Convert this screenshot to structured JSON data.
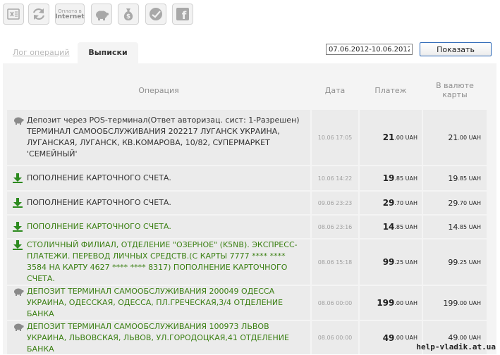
{
  "toolbar": {
    "buttons": [
      {
        "icon": "excel-icon"
      },
      {
        "icon": "refresh-icon"
      },
      {
        "icon": "internet-payment-icon",
        "line1": "Оплата в",
        "line2": "Internet"
      },
      {
        "icon": "piggy-bank-icon"
      },
      {
        "icon": "money-bag-icon"
      },
      {
        "icon": "check-circle-icon"
      },
      {
        "icon": "facebook-icon",
        "glyph": "f"
      }
    ]
  },
  "tabs": {
    "log": "Лог операций",
    "statements": "Выписки"
  },
  "filter": {
    "date_range": "07.06.2012-10.06.2012",
    "show_button": "Показать"
  },
  "table": {
    "headers": {
      "operation": "Операция",
      "date": "Дата",
      "payment": "Платеж",
      "card_currency_line1": "В валюте",
      "card_currency_line2": "карты"
    },
    "rows": [
      {
        "icon": "piggy-bank-icon",
        "text": "Депозит через POS-терминал(Ответ авторизац. сист: 1-Разрешен) ТЕРМИНАЛ САМООБСЛУЖИВАНИЯ 202217 ЛУГАНСК УКРАИНА, ЛУГАНСКАЯ, ЛУГАНСК, КВ.КОМАРОВА, 10/82, СУПЕРМАРКЕТ 'СЕМЕЙНЫЙ'",
        "green": false,
        "date": "10.06 17:05",
        "pay_int": "21",
        "pay_dec": ".00 UAH",
        "card_int": "21",
        "card_dec": ".00 UAH"
      },
      {
        "icon": "arrow-down-icon",
        "text": "ПОПОЛНЕНИЕ КАРТОЧНОГО СЧЕТА.",
        "green": false,
        "date": "10.06 14:22",
        "pay_int": "19",
        "pay_dec": ".85 UAH",
        "card_int": "19",
        "card_dec": ".85 UAH"
      },
      {
        "icon": "arrow-down-icon",
        "text": "ПОПОЛНЕНИЕ КАРТОЧНОГО СЧЕТА.",
        "green": false,
        "date": "09.06 23:23",
        "pay_int": "29",
        "pay_dec": ".70 UAH",
        "card_int": "29",
        "card_dec": ".70 UAH"
      },
      {
        "icon": "arrow-down-icon",
        "text": "ПОПОЛНЕНИЕ КАРТОЧНОГО СЧЕТА.",
        "green": true,
        "date": "08.06 23:16",
        "pay_int": "14",
        "pay_dec": ".85 UAH",
        "card_int": "14",
        "card_dec": ".85 UAH"
      },
      {
        "icon": "arrow-down-icon",
        "text": "СТОЛИЧНЫЙ ФИЛИАЛ, ОТДЕЛЕНИЕ \"ОЗЕРНОЕ\" (K5NB). ЭКСПРЕСС-ПЛАТЕЖИ. ПЕРЕВОД ЛИЧНЫХ СРЕДСТВ.(С КАРТЫ 7777 **** **** 3584 НА КАРТУ 4627 **** **** 8317) ПОПОЛНЕНИЕ КАРТОЧНОГО СЧЕТА.",
        "green": true,
        "date": "08.06 15:18",
        "pay_int": "99",
        "pay_dec": ".25 UAH",
        "card_int": "99",
        "card_dec": ".25 UAH"
      },
      {
        "icon": "piggy-bank-icon",
        "text": "ДЕПОЗИТ ТЕРМИНАЛ САМООБСЛУЖИВАНИЯ 200049 ОДЕССА УКРАИНА, ОДЕССКАЯ, ОДЕССА, ПЛ.ГРЕЧЕСКАЯ,3/4 ОТДЕЛЕНИЕ БАНКА",
        "green": true,
        "date": "08.06 00:00",
        "pay_int": "199",
        "pay_dec": ".00 UAH",
        "card_int": "199",
        "card_dec": ".00 UAH"
      },
      {
        "icon": "piggy-bank-icon",
        "text": "ДЕПОЗИТ ТЕРМИНАЛ САМООБСЛУЖИВАНИЯ 100973 ЛЬВОВ УКРАИНА, ЛЬВОВСКАЯ, ЛЬВОВ, УЛ.ГОРОДОЦКАЯ,41 ОТДЕЛЕНИЕ БАНКА",
        "green": true,
        "date": "08.06 00:00",
        "pay_int": "49",
        "pay_dec": ".00 UAH",
        "card_int": "49",
        "card_dec": ".00 UAH"
      }
    ]
  },
  "watermark": "help-vladik.at.ua",
  "colors": {
    "green_text": "#3a7f12",
    "icon_green": "#2d8a1f",
    "cell_bg": "#ebebeb",
    "panel_bg": "#f4f4f4",
    "button_border": "#2b67b6"
  }
}
